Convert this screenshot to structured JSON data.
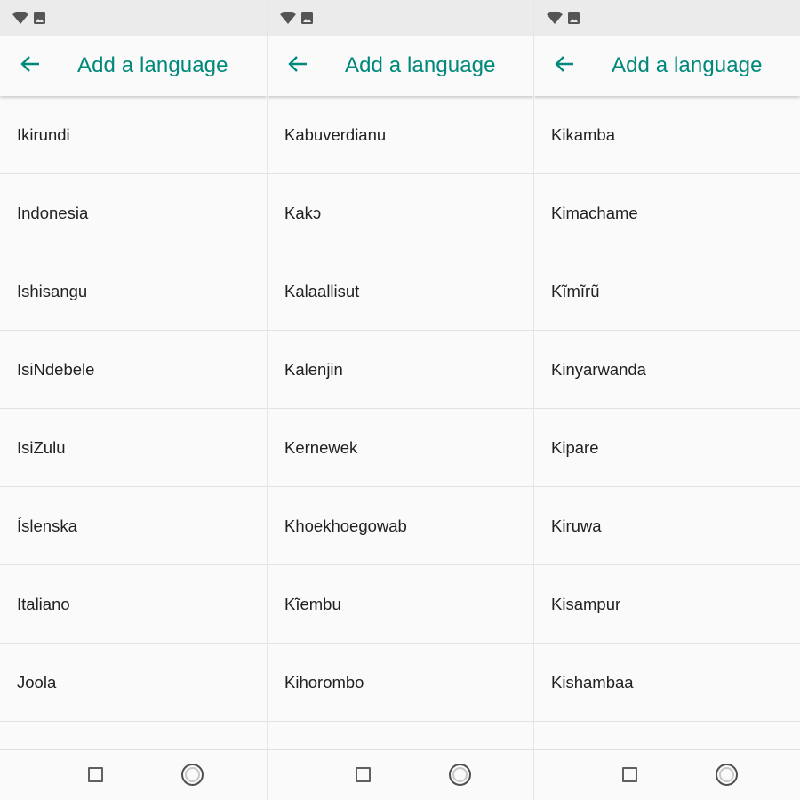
{
  "accent_color": "#00897b",
  "icons": {
    "status": [
      "wifi-icon",
      "image-icon"
    ],
    "back": "arrow-left-icon",
    "recents": "square-icon",
    "home": "circle-icon"
  },
  "panels": [
    {
      "title": "Add a language",
      "items": [
        "Ikirundi",
        "Indonesia",
        "Ishisangu",
        "IsiNdebele",
        "IsiZulu",
        "Íslenska",
        "Italiano",
        "Joola"
      ]
    },
    {
      "title": "Add a language",
      "items": [
        "Kabuverdianu",
        "Kakɔ",
        "Kalaallisut",
        "Kalenjin",
        "Kernewek",
        "Khoekhoegowab",
        "Kĩembu",
        "Kihorombo"
      ]
    },
    {
      "title": "Add a language",
      "items": [
        "Kikamba",
        "Kimachame",
        "Kĩmĩrũ",
        "Kinyarwanda",
        "Kipare",
        "Kiruwa",
        "Kisampur",
        "Kishambaa"
      ]
    }
  ]
}
